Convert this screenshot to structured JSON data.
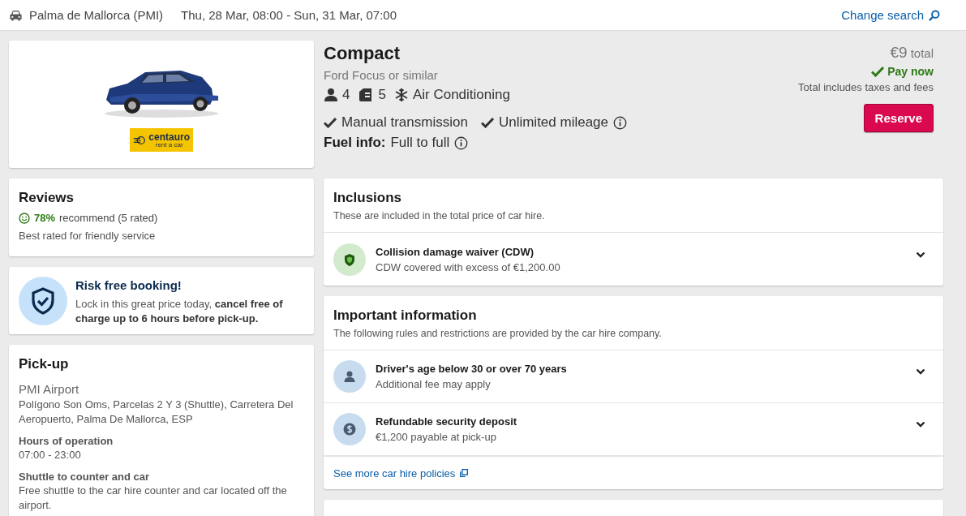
{
  "header": {
    "location": "Palma de Mallorca (PMI)",
    "dates": "Thu, 28 Mar, 08:00 - Sun, 31 Mar, 07:00",
    "change_search": "Change search"
  },
  "car": {
    "supplier_logo": {
      "name": "centauro",
      "tagline": "rent a car"
    },
    "category": "Compact",
    "model": "Ford Focus or similar",
    "specs": [
      {
        "kind": "seats",
        "text": "4"
      },
      {
        "kind": "bags",
        "text": "5"
      },
      {
        "kind": "ac",
        "text": "Air Conditioning"
      }
    ],
    "features": [
      {
        "text": "Manual transmission",
        "info": false
      },
      {
        "text": "Unlimited mileage",
        "info": true
      }
    ],
    "fuel": {
      "label": "Fuel info:",
      "value": "Full to full",
      "info": true
    }
  },
  "price": {
    "amount": "€9",
    "suffix": "total",
    "pay_now": "Pay now",
    "note": "Total includes taxes and fees",
    "button": "Reserve"
  },
  "reviews": {
    "title": "Reviews",
    "percent": "78%",
    "recommend": "recommend (5 rated)",
    "note": "Best rated for friendly service"
  },
  "risk_free": {
    "title": "Risk free booking!",
    "text": "Lock in this great price today, **cancel free of charge up to 6 hours before pick-up.**"
  },
  "pickup": {
    "title": "Pick-up",
    "location": "PMI Airport",
    "address": "Polígono Son Oms, Parcelas 2 Y 3 (Shuttle), Carretera Del Aeropuerto, Palma De Mallorca, ESP",
    "sections": [
      {
        "heading": "Hours of operation",
        "text": "07:00 - 23:00"
      },
      {
        "heading": "Shuttle to counter and car",
        "text": "Free shuttle to the car hire counter and car located off the airport."
      }
    ]
  },
  "inclusions": {
    "title": "Inclusions",
    "subtitle": "These are included in the total price of car hire.",
    "items": [
      {
        "kind": "shield",
        "title": "Collision damage waiver (CDW)",
        "text": "CDW covered with excess of €1,200.00",
        "expanded": false
      }
    ]
  },
  "important": {
    "title": "Important information",
    "subtitle": "The following rules and restrictions are provided by the car hire company.",
    "items": [
      {
        "kind": "person",
        "title": "Driver's age below 30 or over 70 years",
        "text": "Additional fee may apply",
        "expanded": false
      },
      {
        "kind": "money",
        "title": "Refundable security deposit",
        "text": "€1,200 payable at pick-up",
        "expanded": false
      }
    ],
    "link": "See more car hire policies"
  }
}
